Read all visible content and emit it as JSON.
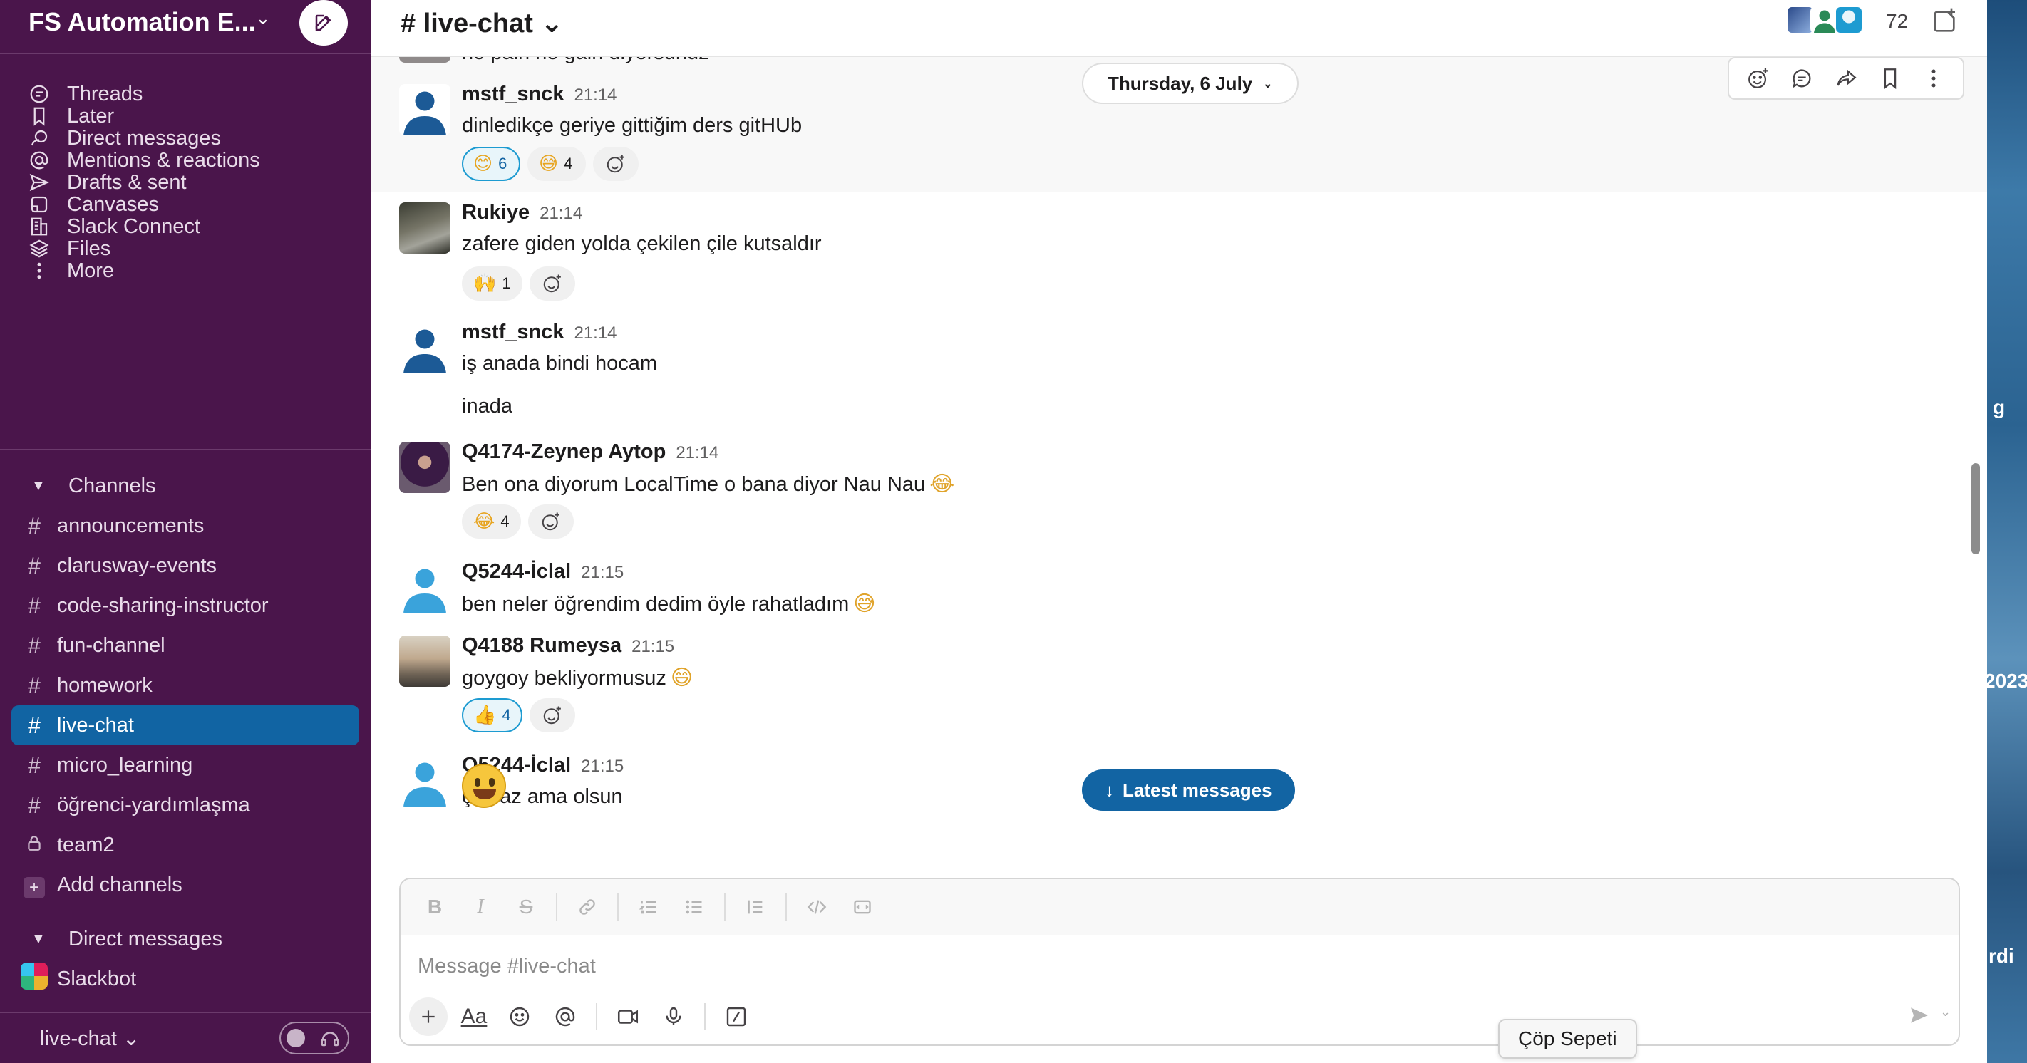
{
  "workspace": {
    "name": "FS Automation E...",
    "chevron": "⌄"
  },
  "nav": [
    {
      "label": "Threads",
      "icon": "threads-icon"
    },
    {
      "label": "Later",
      "icon": "bookmark-icon"
    },
    {
      "label": "Direct messages",
      "icon": "dm-icon"
    },
    {
      "label": "Mentions & reactions",
      "icon": "at-icon"
    },
    {
      "label": "Drafts & sent",
      "icon": "send-icon"
    },
    {
      "label": "Canvases",
      "icon": "canvas-icon"
    },
    {
      "label": "Slack Connect",
      "icon": "building-icon"
    },
    {
      "label": "Files",
      "icon": "files-icon"
    },
    {
      "label": "More",
      "icon": "more-icon"
    }
  ],
  "channels_section": {
    "title": "Channels",
    "items": [
      {
        "label": "announcements"
      },
      {
        "label": "clarusway-events"
      },
      {
        "label": "code-sharing-instructor"
      },
      {
        "label": "fun-channel"
      },
      {
        "label": "homework"
      },
      {
        "label": "live-chat"
      },
      {
        "label": "micro_learning"
      },
      {
        "label": "öğrenci-yardımlaşma"
      },
      {
        "label": "team2"
      }
    ],
    "add_label": "Add channels"
  },
  "dm_section": {
    "title": "Direct messages",
    "items": [
      {
        "label": "Slackbot"
      }
    ]
  },
  "sidebar_footer": {
    "label": "live-chat ⌄"
  },
  "channel": {
    "title": "# live-chat ⌄",
    "member_count": "72"
  },
  "date_divider": {
    "label": "Thursday, 6 July"
  },
  "prev_cut_text": "no pain no gain diyorsunuz",
  "messages": [
    {
      "name": "mstf_snck",
      "time": "21:14",
      "text": "dinledikçe geriye gittiğim ders gitHUb",
      "reactions": [
        {
          "emoji": "😊",
          "count": "6"
        },
        {
          "emoji": "😅",
          "count": "4"
        }
      ]
    },
    {
      "name": "Rukiye",
      "time": "21:14",
      "text": "zafere giden yolda çekilen çile kutsaldır",
      "reactions": [
        {
          "emoji": "🙌",
          "count": "1"
        }
      ]
    },
    {
      "name": "mstf_snck",
      "time": "21:14",
      "text": "iş anada bindi hocam",
      "text2": "inada"
    },
    {
      "name": "Q4174-Zeynep Aytop",
      "time": "21:14",
      "text": "Ben ona diyorum LocalTime o bana diyor Nau Nau",
      "emoji": "😂",
      "reactions": [
        {
          "emoji": "😂",
          "count": "4"
        }
      ]
    },
    {
      "name": "Q5244-İclal",
      "time": "21:15",
      "text": "ben neler öğrendim dedim öyle rahatladım",
      "emoji": "😅"
    },
    {
      "name": "Q4188 Rumeysa",
      "time": "21:15",
      "text": "goygoy bekliyormusuz",
      "emoji": "😄",
      "reactions": [
        {
          "emoji": "👍",
          "count": "4"
        }
      ]
    },
    {
      "name": "Q5244-İclal",
      "time": "21:15",
      "text": "çok az ama olsun"
    }
  ],
  "latest_messages": {
    "label": "Latest messages",
    "arrow": "↓"
  },
  "composer": {
    "placeholder": "Message #live-chat",
    "format_buttons": [
      "B",
      "I",
      "S"
    ],
    "aa_label": "Aa"
  },
  "tooltip": {
    "label": "Çöp Sepeti"
  },
  "wallpaper": {
    "texts": [
      "g",
      "2023",
      "rdi"
    ]
  },
  "colors": {
    "sidebar": "#4a154b",
    "active": "#1164a3",
    "accent": "#1264a3"
  }
}
